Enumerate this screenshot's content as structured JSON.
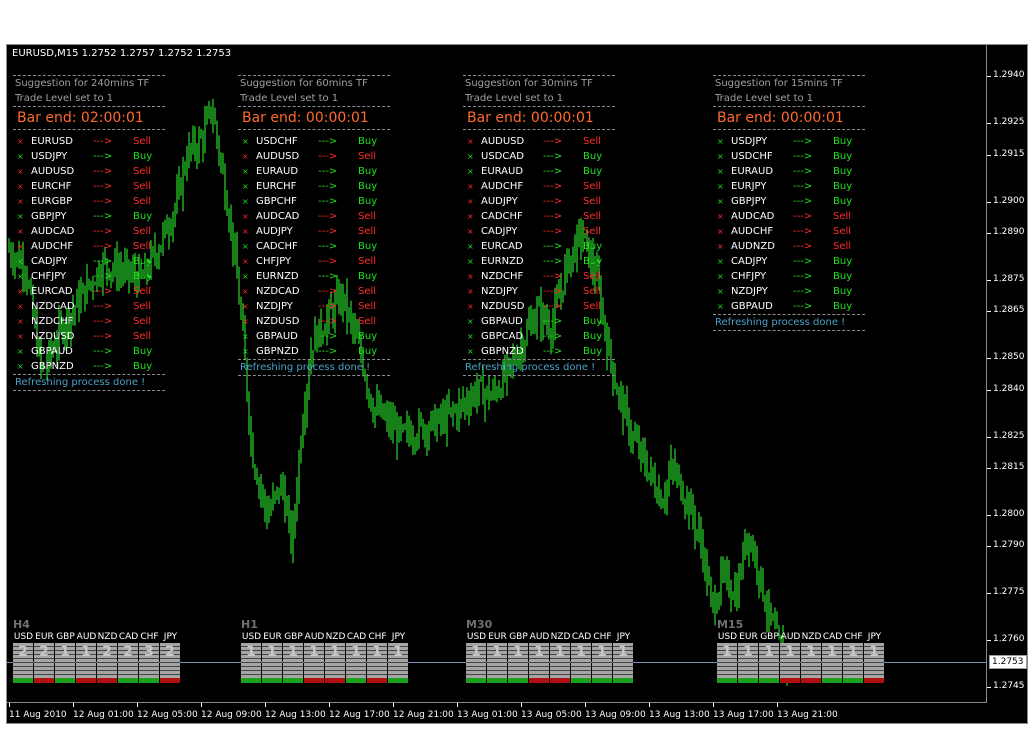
{
  "chart_data": {
    "type": "candlestick",
    "title": "EURUSD,M15  1.2752 1.2757 1.2752 1.2753",
    "symbol": "EURUSD",
    "timeframe": "M15",
    "ohlc": {
      "open": 1.2752,
      "high": 1.2757,
      "low": 1.2752,
      "close": 1.2753
    },
    "current_price": "1.2753",
    "y_ticks": [
      "1.2940",
      "1.2925",
      "1.2915",
      "1.2900",
      "1.2890",
      "1.2875",
      "1.2865",
      "1.2850",
      "1.2840",
      "1.2825",
      "1.2815",
      "1.2800",
      "1.2790",
      "1.2775",
      "1.2760",
      "1.2745"
    ],
    "x_ticks": [
      "11 Aug 2010",
      "12 Aug 01:00",
      "12 Aug 05:00",
      "12 Aug 09:00",
      "12 Aug 13:00",
      "12 Aug 17:00",
      "12 Aug 21:00",
      "13 Aug 01:00",
      "13 Aug 05:00",
      "13 Aug 09:00",
      "13 Aug 13:00",
      "13 Aug 17:00",
      "13 Aug 21:00"
    ],
    "ylim": [
      1.274,
      1.295
    ],
    "series_color": "#30ff30",
    "approx_close_path": [
      [
        0,
        1.2885
      ],
      [
        18,
        1.288
      ],
      [
        35,
        1.2845
      ],
      [
        55,
        1.286
      ],
      [
        75,
        1.287
      ],
      [
        95,
        1.288
      ],
      [
        115,
        1.2878
      ],
      [
        135,
        1.2875
      ],
      [
        155,
        1.2888
      ],
      [
        170,
        1.29
      ],
      [
        180,
        1.2915
      ],
      [
        195,
        1.292
      ],
      [
        205,
        1.293
      ],
      [
        215,
        1.291
      ],
      [
        225,
        1.289
      ],
      [
        235,
        1.286
      ],
      [
        245,
        1.282
      ],
      [
        260,
        1.28
      ],
      [
        275,
        1.281
      ],
      [
        285,
        1.279
      ],
      [
        295,
        1.283
      ],
      [
        305,
        1.2855
      ],
      [
        315,
        1.286
      ],
      [
        325,
        1.2865
      ],
      [
        335,
        1.287
      ],
      [
        345,
        1.286
      ],
      [
        355,
        1.285
      ],
      [
        365,
        1.2835
      ],
      [
        380,
        1.283
      ],
      [
        395,
        1.2825
      ],
      [
        415,
        1.2828
      ],
      [
        435,
        1.283
      ],
      [
        455,
        1.2835
      ],
      [
        470,
        1.284
      ],
      [
        485,
        1.2838
      ],
      [
        500,
        1.2845
      ],
      [
        515,
        1.2855
      ],
      [
        530,
        1.2865
      ],
      [
        545,
        1.286
      ],
      [
        560,
        1.288
      ],
      [
        575,
        1.289
      ],
      [
        590,
        1.2875
      ],
      [
        600,
        1.2855
      ],
      [
        610,
        1.284
      ],
      [
        625,
        1.2825
      ],
      [
        640,
        1.2815
      ],
      [
        655,
        1.2805
      ],
      [
        665,
        1.2815
      ],
      [
        680,
        1.2805
      ],
      [
        695,
        1.279
      ],
      [
        705,
        1.277
      ],
      [
        715,
        1.278
      ],
      [
        730,
        1.2775
      ],
      [
        740,
        1.2795
      ],
      [
        750,
        1.2785
      ],
      [
        760,
        1.277
      ],
      [
        770,
        1.276
      ],
      [
        780,
        1.2753
      ]
    ]
  },
  "suggestions": [
    {
      "title": "Suggestion for 240mins TF",
      "level": "Trade Level set to 1",
      "bar_end": "Bar end: 02:00:01",
      "rows": [
        [
          "EURUSD",
          "Sell"
        ],
        [
          "USDJPY",
          "Buy"
        ],
        [
          "AUDUSD",
          "Sell"
        ],
        [
          "EURCHF",
          "Sell"
        ],
        [
          "EURGBP",
          "Sell"
        ],
        [
          "GBPJPY",
          "Buy"
        ],
        [
          "AUDCAD",
          "Sell"
        ],
        [
          "AUDCHF",
          "Sell"
        ],
        [
          "CADJPY",
          "Buy"
        ],
        [
          "CHFJPY",
          "Buy"
        ],
        [
          "EURCAD",
          "Sell"
        ],
        [
          "NZDCAD",
          "Sell"
        ],
        [
          "NZDCHF",
          "Sell"
        ],
        [
          "NZDUSD",
          "Sell"
        ],
        [
          "GBPAUD",
          "Buy"
        ],
        [
          "GBPNZD",
          "Buy"
        ]
      ],
      "footer": "Refreshing process done !"
    },
    {
      "title": "Suggestion for 60mins TF",
      "level": "Trade Level set to 1",
      "bar_end": "Bar end: 00:00:01",
      "rows": [
        [
          "USDCHF",
          "Buy"
        ],
        [
          "AUDUSD",
          "Sell"
        ],
        [
          "EURAUD",
          "Buy"
        ],
        [
          "EURCHF",
          "Buy"
        ],
        [
          "GBPCHF",
          "Buy"
        ],
        [
          "AUDCAD",
          "Sell"
        ],
        [
          "AUDJPY",
          "Sell"
        ],
        [
          "CADCHF",
          "Buy"
        ],
        [
          "CHFJPY",
          "Sell"
        ],
        [
          "EURNZD",
          "Buy"
        ],
        [
          "NZDCAD",
          "Sell"
        ],
        [
          "NZDJPY",
          "Sell"
        ],
        [
          "NZDUSD",
          "Sell"
        ],
        [
          "GBPAUD",
          "Buy"
        ],
        [
          "GBPNZD",
          "Buy"
        ]
      ],
      "footer": "Refreshing process done !"
    },
    {
      "title": "Suggestion for 30mins TF",
      "level": "Trade Level set to 1",
      "bar_end": "Bar end: 00:00:01",
      "rows": [
        [
          "AUDUSD",
          "Sell"
        ],
        [
          "USDCAD",
          "Buy"
        ],
        [
          "EURAUD",
          "Buy"
        ],
        [
          "AUDCHF",
          "Sell"
        ],
        [
          "AUDJPY",
          "Sell"
        ],
        [
          "CADCHF",
          "Sell"
        ],
        [
          "CADJPY",
          "Sell"
        ],
        [
          "EURCAD",
          "Buy"
        ],
        [
          "EURNZD",
          "Buy"
        ],
        [
          "NZDCHF",
          "Sell"
        ],
        [
          "NZDJPY",
          "Sell"
        ],
        [
          "NZDUSD",
          "Sell"
        ],
        [
          "GBPAUD",
          "Buy"
        ],
        [
          "GBPCAD",
          "Buy"
        ],
        [
          "GBPNZD",
          "Buy"
        ]
      ],
      "footer": "Refreshing process done !"
    },
    {
      "title": "Suggestion for 15mins TF",
      "level": "Trade Level set to 1",
      "bar_end": "Bar end: 00:00:01",
      "rows": [
        [
          "USDJPY",
          "Buy"
        ],
        [
          "USDCHF",
          "Buy"
        ],
        [
          "EURAUD",
          "Buy"
        ],
        [
          "EURJPY",
          "Buy"
        ],
        [
          "GBPJPY",
          "Buy"
        ],
        [
          "AUDCAD",
          "Sell"
        ],
        [
          "AUDCHF",
          "Sell"
        ],
        [
          "AUDNZD",
          "Sell"
        ],
        [
          "CADJPY",
          "Buy"
        ],
        [
          "CHFJPY",
          "Buy"
        ],
        [
          "NZDJPY",
          "Buy"
        ],
        [
          "GBPAUD",
          "Buy"
        ]
      ],
      "footer": "Refreshing process done !"
    }
  ],
  "strength_meters": [
    {
      "tf": "H4",
      "currencies": [
        "USD",
        "EUR",
        "GBP",
        "AUD",
        "NZD",
        "CAD",
        "CHF",
        "JPY"
      ],
      "values": [
        "2",
        "2",
        "1",
        "1",
        "2",
        "2",
        "3",
        "2"
      ],
      "bars": [
        "green",
        "red",
        "green",
        "red",
        "red",
        "green",
        "green",
        "red"
      ]
    },
    {
      "tf": "H1",
      "currencies": [
        "USD",
        "EUR",
        "GBP",
        "AUD",
        "NZD",
        "CAD",
        "CHF",
        "JPY"
      ],
      "values": [
        "1",
        "1",
        "1",
        "1",
        "1",
        "1",
        "1",
        "1"
      ],
      "bars": [
        "green",
        "green",
        "green",
        "red",
        "red",
        "green",
        "red",
        "green"
      ]
    },
    {
      "tf": "M30",
      "currencies": [
        "USD",
        "EUR",
        "GBP",
        "AUD",
        "NZD",
        "CAD",
        "CHF",
        "JPY"
      ],
      "values": [
        "1",
        "1",
        "1",
        "1",
        "1",
        "1",
        "1",
        "1"
      ],
      "bars": [
        "green",
        "green",
        "green",
        "red",
        "red",
        "green",
        "green",
        "green"
      ]
    },
    {
      "tf": "M15",
      "currencies": [
        "USD",
        "EUR",
        "GBP",
        "AUD",
        "NZD",
        "CAD",
        "CHF",
        "JPY"
      ],
      "values": [
        "1",
        "1",
        "1",
        "1",
        "1",
        "1",
        "1",
        "1"
      ],
      "bars": [
        "green",
        "green",
        "green",
        "red",
        "red",
        "green",
        "green",
        "red"
      ]
    }
  ],
  "arrow": "--->",
  "mark": "×"
}
